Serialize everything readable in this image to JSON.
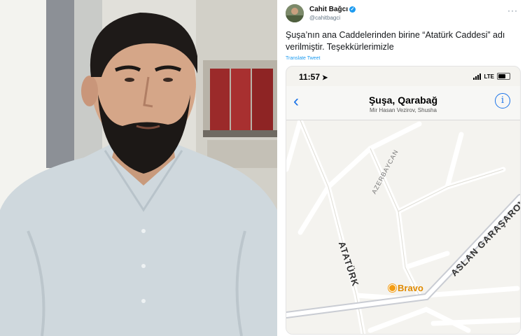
{
  "tweet": {
    "author_name": "Cahit Bağcı",
    "handle": "@cahitbagci",
    "more_icon": "more-horizontal-icon",
    "text": "Şuşa’nın ana Caddelerinden birine “Atatürk Caddesi” adı verilmiştir. Teşekkürlerimizle",
    "translate_label": "Translate Tweet"
  },
  "phone": {
    "time": "11:57",
    "network": "LTE",
    "nav_title": "Şuşa, Qarabağ",
    "nav_subtitle": "Mir Hasan Vezirov, Shusha",
    "back_icon": "chevron-left-icon",
    "info_icon": "info-icon",
    "map_labels": {
      "azerbaycan": "AZERBAYCAN",
      "ataturk": "ATATÜRK",
      "aslan": "ASLAN GARAŞAROV",
      "poi": "Bravo"
    }
  },
  "colors": {
    "accent": "#1d9bf0",
    "ios_blue": "#1a73e8",
    "poi": "#f39c12",
    "map_bg": "#f4f3ef"
  }
}
